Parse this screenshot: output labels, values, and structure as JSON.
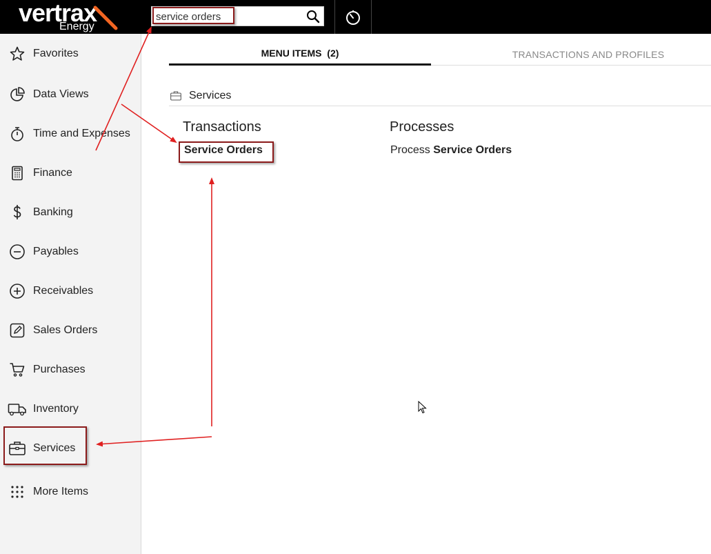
{
  "brand": {
    "name": "vertrax",
    "sub": "Energy",
    "accent": "#f26522"
  },
  "search": {
    "value": "service orders",
    "placeholder": ""
  },
  "sidebar": {
    "items": [
      {
        "label": "Favorites",
        "icon": "star-icon"
      },
      {
        "label": "Data Views",
        "icon": "pie-chart-icon"
      },
      {
        "label": "Time and Expenses",
        "icon": "stopwatch-icon"
      },
      {
        "label": "Finance",
        "icon": "calculator-icon"
      },
      {
        "label": "Banking",
        "icon": "dollar-icon"
      },
      {
        "label": "Payables",
        "icon": "minus-circle-icon"
      },
      {
        "label": "Receivables",
        "icon": "plus-circle-icon"
      },
      {
        "label": "Sales Orders",
        "icon": "pencil-square-icon"
      },
      {
        "label": "Purchases",
        "icon": "cart-icon"
      },
      {
        "label": "Inventory",
        "icon": "truck-icon"
      },
      {
        "label": "Services",
        "icon": "briefcase-icon"
      },
      {
        "label": "More Items",
        "icon": "grid-dots-icon"
      }
    ]
  },
  "tabs": {
    "menu_items": "MENU ITEMS  (2)",
    "transactions_profiles": "TRANSACTIONS AND PROFILES"
  },
  "section": {
    "label": "Services",
    "icon": "briefcase-icon"
  },
  "columns": {
    "transactions": {
      "title": "Transactions",
      "link": "Service Orders"
    },
    "processes": {
      "title": "Processes",
      "prefix": "Process ",
      "link": "Service Orders"
    }
  },
  "annotation_color": "#e02020"
}
